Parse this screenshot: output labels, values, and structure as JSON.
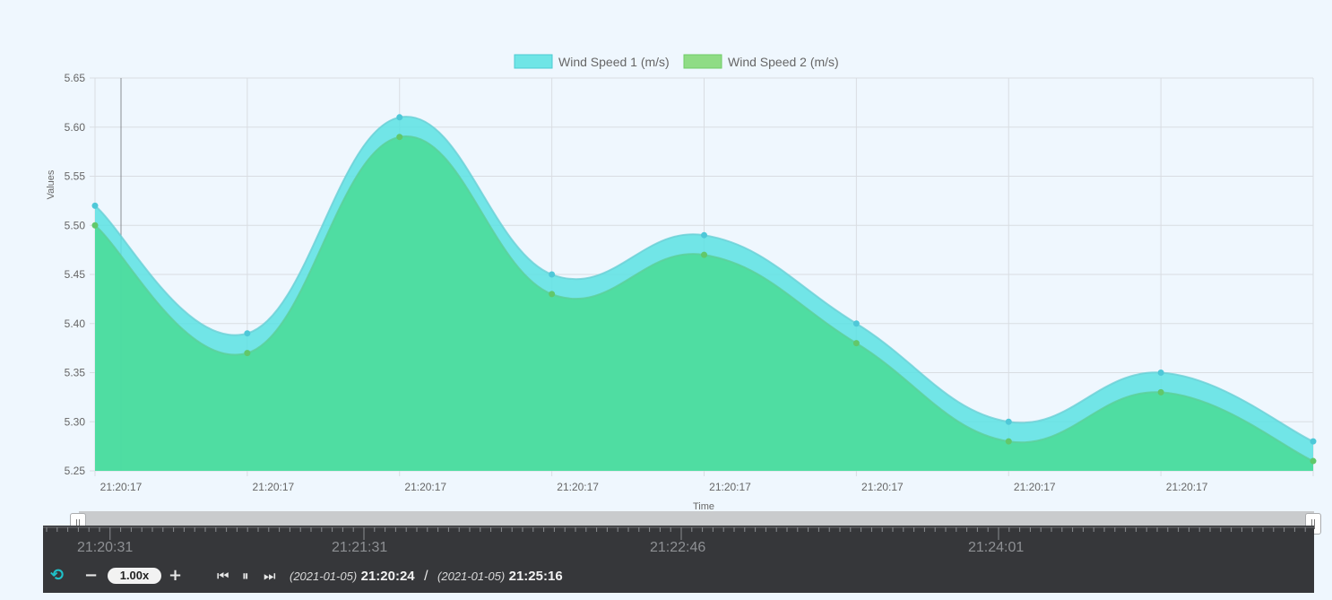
{
  "chart_data": {
    "type": "area",
    "x": [
      "21:20:17",
      "21:20:17",
      "21:20:17",
      "21:20:17",
      "21:20:17",
      "21:20:17",
      "21:20:17",
      "21:20:17",
      "21:20:17"
    ],
    "x_tick_labels": [
      "21:20:17",
      "21:20:17",
      "21:20:17",
      "21:20:17",
      "21:20:17",
      "21:20:17",
      "21:20:17",
      "21:20:17"
    ],
    "series": [
      {
        "name": "Wind Speed 1 (m/s)",
        "values": [
          5.52,
          5.39,
          5.61,
          5.45,
          5.49,
          5.4,
          5.3,
          5.35,
          5.28
        ],
        "color": "#5ae2e3"
      },
      {
        "name": "Wind Speed 2 (m/s)",
        "values": [
          5.5,
          5.37,
          5.59,
          5.43,
          5.47,
          5.38,
          5.28,
          5.33,
          5.26
        ],
        "color": "#4ddc9e"
      }
    ],
    "xlabel": "Time",
    "ylabel": "Values",
    "ylim": [
      5.25,
      5.65
    ],
    "y_ticks": [
      "5.25",
      "5.30",
      "5.35",
      "5.40",
      "5.45",
      "5.50",
      "5.55",
      "5.60",
      "5.65"
    ],
    "grid": true,
    "legend_position": "top-center"
  },
  "timeline": {
    "labels": [
      "21:20:31",
      "21:21:31",
      "21:22:46",
      "21:24:01"
    ],
    "speed": "1.00x",
    "start_date": "(2021-01-05)",
    "start_time": "21:20:24",
    "separator": "/",
    "end_date": "(2021-01-05)",
    "end_time": "21:25:16"
  },
  "colors": {
    "legend_swatch_1": "#6fe5e6",
    "legend_swatch_2": "#8fdc85",
    "accent": "#1fc1c9"
  }
}
